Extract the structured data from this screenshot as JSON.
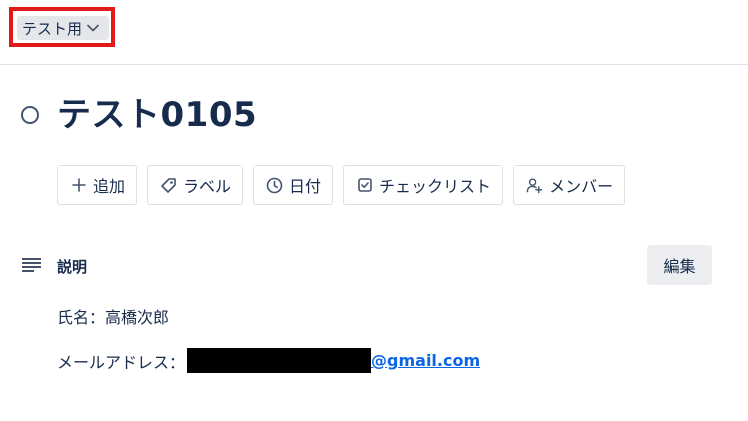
{
  "header": {
    "list_name": "テスト用",
    "icon": "chevron-down-icon"
  },
  "card": {
    "title": "テスト0105"
  },
  "actions": [
    {
      "label": "追加",
      "icon": "plus-icon"
    },
    {
      "label": "ラベル",
      "icon": "tag-icon"
    },
    {
      "label": "日付",
      "icon": "clock-icon"
    },
    {
      "label": "チェックリスト",
      "icon": "checkbox-icon"
    },
    {
      "label": "メンバー",
      "icon": "add-person-icon"
    }
  ],
  "description": {
    "heading": "説明",
    "edit_label": "編集",
    "name_line": "氏名：高橋次郎",
    "email_prefix": "メールアドレス：",
    "email_domain": "@gmail.com"
  },
  "colors": {
    "highlight": "#e11b1b",
    "link": "#0c66e4",
    "text": "#172b4d"
  }
}
